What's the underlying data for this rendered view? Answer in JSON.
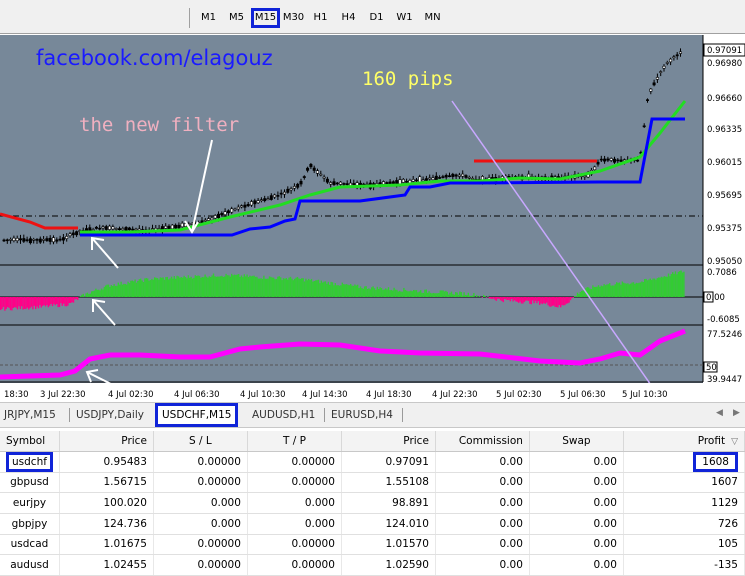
{
  "toolbar": {
    "timeframes": [
      "M1",
      "M5",
      "M15",
      "M30",
      "H1",
      "H4",
      "D1",
      "W1",
      "MN"
    ],
    "active": "M15"
  },
  "chart": {
    "annotations": {
      "brand": "facebook.com/elagouz",
      "filter_label": "the new filter",
      "pips_label": "160 pips"
    },
    "price_scale": {
      "labels": [
        "0.97091",
        "0.96980",
        "0.96660",
        "0.96335",
        "0.96015",
        "0.95695",
        "0.95375",
        "0.95050"
      ],
      "current": "0.97091"
    },
    "indicator1": {
      "labels": [
        "0.7086",
        "0.00",
        "-0.6085"
      ]
    },
    "indicator2": {
      "labels": [
        "77.5246",
        "50",
        "39.9447"
      ]
    },
    "time_labels": [
      "18:30",
      "3 Jul 22:30",
      "4 Jul 02:30",
      "4 Jul 06:30",
      "4 Jul 10:30",
      "4 Jul 14:30",
      "4 Jul 18:30",
      "4 Jul 22:30",
      "5 Jul 02:30",
      "5 Jul 06:30",
      "5 Jul 10:30"
    ],
    "colors": {
      "background": "#778899",
      "candle": "#000000",
      "green_line": "#22dd22",
      "blue_line": "#0000ff",
      "red_line": "#ee1111",
      "magenta_line": "#ff00ff",
      "histogram_up": "#33cc33",
      "histogram_down": "#ff0088",
      "annotation_blue": "#1a1aff",
      "annotation_pink": "#f0b0c0",
      "annotation_yellow": "#ffff66",
      "arrow_violet": "#c8a8ff"
    }
  },
  "tabs": {
    "items": [
      "JRJPY,M15",
      "USDJPY,Daily",
      "USDCHF,M15",
      "AUDUSD,H1",
      "EURUSD,H4"
    ],
    "active": "USDCHF,M15"
  },
  "table": {
    "headers": [
      "Symbol",
      "Price",
      "S / L",
      "T / P",
      "Price",
      "Commission",
      "Swap",
      "Profit"
    ],
    "rows": [
      [
        "usdchf",
        "0.95483",
        "0.00000",
        "0.00000",
        "0.97091",
        "0.00",
        "0.00",
        "1608"
      ],
      [
        "gbpusd",
        "1.56715",
        "0.00000",
        "0.00000",
        "1.55108",
        "0.00",
        "0.00",
        "1607"
      ],
      [
        "eurjpy",
        "100.020",
        "0.000",
        "0.000",
        "98.891",
        "0.00",
        "0.00",
        "1129"
      ],
      [
        "gbpjpy",
        "124.736",
        "0.000",
        "0.000",
        "124.010",
        "0.00",
        "0.00",
        "726"
      ],
      [
        "usdcad",
        "1.01675",
        "0.00000",
        "0.00000",
        "1.01570",
        "0.00",
        "0.00",
        "105"
      ],
      [
        "audusd",
        "1.02455",
        "0.00000",
        "0.00000",
        "1.02590",
        "0.00",
        "0.00",
        "-135"
      ]
    ]
  }
}
